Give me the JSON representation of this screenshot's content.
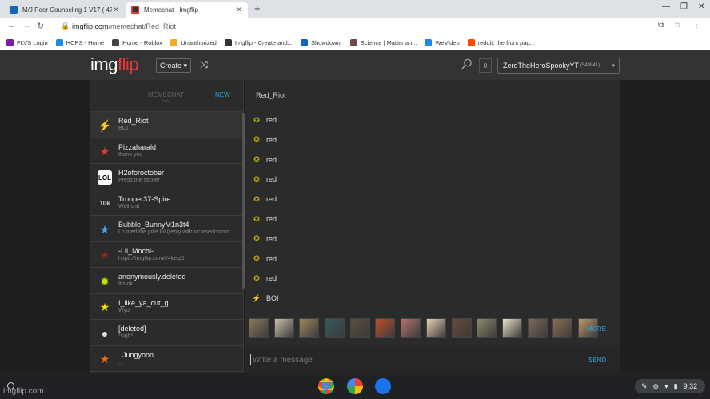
{
  "browser": {
    "tabs": [
      {
        "title": "M/J Peer Counseling 1 V17 ( 47",
        "active": false
      },
      {
        "title": "Memechat - Imgflip",
        "active": true
      }
    ],
    "new_tab": "+",
    "url_host": "imgflip.com",
    "url_path": "/memechat/Red_Riot",
    "bookmarks": [
      {
        "label": "FLVS Login",
        "color": "#7b1fa2"
      },
      {
        "label": "HCPS - Home",
        "color": "#1e88e5"
      },
      {
        "label": "Home - Roblox",
        "color": "#444444"
      },
      {
        "label": "Unauthorized",
        "color": "#f9a825"
      },
      {
        "label": "Imgflip - Create and...",
        "color": "#333333"
      },
      {
        "label": "Showdown!",
        "color": "#1565c0"
      },
      {
        "label": "Science | Matter an...",
        "color": "#6d4c41"
      },
      {
        "label": "WeVideo",
        "color": "#1e88e5"
      },
      {
        "label": "reddit: the front pag...",
        "color": "#ff4500"
      }
    ]
  },
  "site": {
    "logo_a": "img",
    "logo_b": "flip",
    "create_label": "Create ▾",
    "notif_count": "0",
    "username": "ZeroTheHeroSpookyYT",
    "user_points": "(544841)",
    "caret": "▾"
  },
  "sidebar": {
    "title": "MEMECHAT",
    "subtitle": "beta",
    "new_label": "NEW",
    "conversations": [
      {
        "name": "Red_Riot",
        "preview": "BOI",
        "icon": "⚡",
        "color": "#e67e22"
      },
      {
        "name": "Pizzaharald",
        "preview": "thank you",
        "icon": "★",
        "color": "#e53935"
      },
      {
        "name": "H2oforoctober",
        "preview": "Press the sticker",
        "icon": "LOL",
        "color": "#ffffff"
      },
      {
        "name": "Trooper37-Spire",
        "preview": "Well shit",
        "icon": "10k",
        "color": "#cccccc"
      },
      {
        "name": "Bubble_BunnyM1n3t4",
        "preview": "I ruined the joke lol (reply with r/cursedcomm",
        "icon": "★",
        "color": "#42a5f5"
      },
      {
        "name": "-Lil_Mochi-",
        "preview": "https://imgflip.com/i/4keqf1",
        "icon": "★",
        "color": "#8d2b1e"
      },
      {
        "name": "anonymously.deleted",
        "preview": "It's ok",
        "icon": "✹",
        "color": "#c6e000"
      },
      {
        "name": "I_like_ya_cut_g",
        "preview": "Wyd",
        "icon": "★",
        "color": "#f5e000"
      },
      {
        "name": "[deleted]",
        "preview": "*sigh*",
        "icon": "●",
        "color": "#dddddd"
      },
      {
        "name": "..Jungyoon..",
        "preview": "...",
        "icon": "★",
        "color": "#ef6c00"
      }
    ]
  },
  "chat": {
    "header": "Red_Riot",
    "messages": [
      {
        "text": "red",
        "icon": "✪"
      },
      {
        "text": "red",
        "icon": "✪"
      },
      {
        "text": "red",
        "icon": "✪"
      },
      {
        "text": "red",
        "icon": "✪"
      },
      {
        "text": "red",
        "icon": "✪"
      },
      {
        "text": "red",
        "icon": "✪"
      },
      {
        "text": "red",
        "icon": "✪"
      },
      {
        "text": "red",
        "icon": "✪"
      },
      {
        "text": "red",
        "icon": "✪"
      },
      {
        "text": "BOI",
        "icon": "⚡"
      }
    ],
    "template_colors": [
      "#8a7a5a",
      "#c9c0a8",
      "#a0855b",
      "#3b5a5e",
      "#5c4e3f",
      "#c0502a",
      "#b0756a",
      "#e8d0b0",
      "#6a4a3a",
      "#8c8a6a",
      "#e9e2c8",
      "#7a6a5a",
      "#8a6f50",
      "#b89a6c"
    ],
    "more_label": "MORE",
    "compose_placeholder": "Write a message",
    "send_label": "SEND"
  },
  "shelf": {
    "time": "9:32",
    "watermark": "imgflip.com"
  }
}
